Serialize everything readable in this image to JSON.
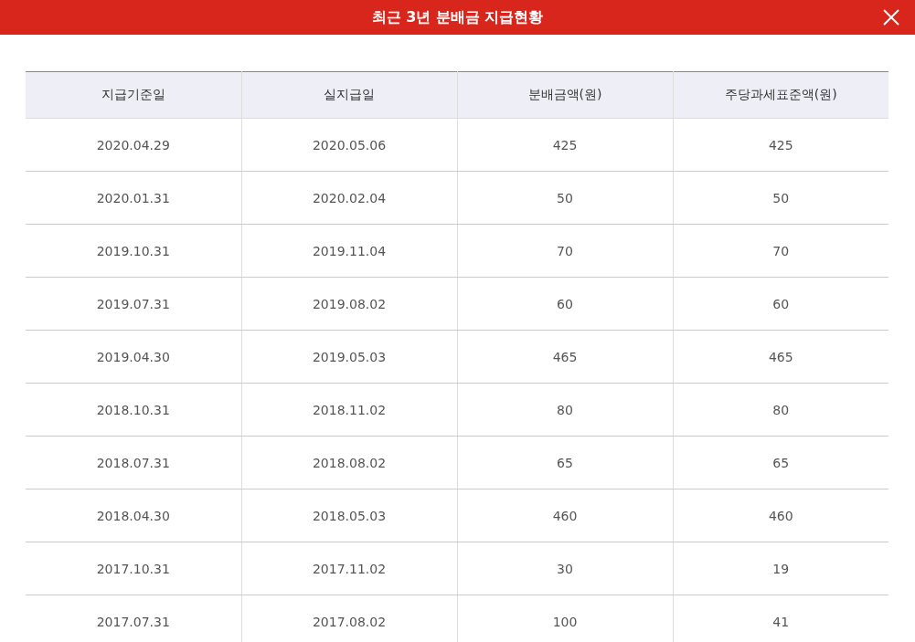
{
  "header": {
    "title": "최근 3년 분배금 지급현황"
  },
  "table": {
    "columns": [
      "지급기준일",
      "실지급일",
      "분배금액(원)",
      "주당과세표준액(원)"
    ],
    "rows": [
      [
        "2020.04.29",
        "2020.05.06",
        "425",
        "425"
      ],
      [
        "2020.01.31",
        "2020.02.04",
        "50",
        "50"
      ],
      [
        "2019.10.31",
        "2019.11.04",
        "70",
        "70"
      ],
      [
        "2019.07.31",
        "2019.08.02",
        "60",
        "60"
      ],
      [
        "2019.04.30",
        "2019.05.03",
        "465",
        "465"
      ],
      [
        "2018.10.31",
        "2018.11.02",
        "80",
        "80"
      ],
      [
        "2018.07.31",
        "2018.08.02",
        "65",
        "65"
      ],
      [
        "2018.04.30",
        "2018.05.03",
        "460",
        "460"
      ],
      [
        "2017.10.31",
        "2017.11.02",
        "30",
        "19"
      ],
      [
        "2017.07.31",
        "2017.08.02",
        "100",
        "41"
      ]
    ]
  }
}
